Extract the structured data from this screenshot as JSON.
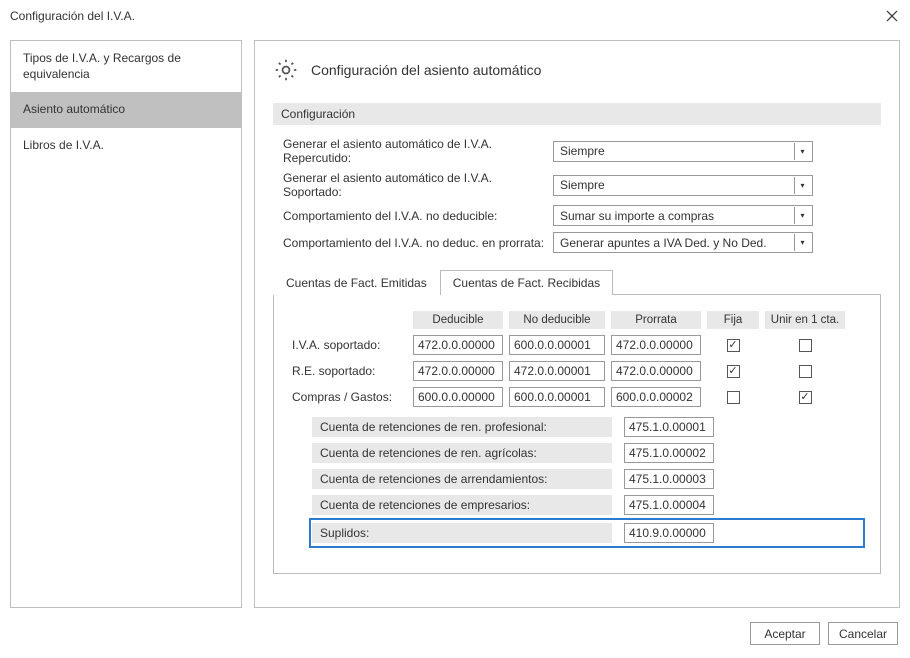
{
  "window": {
    "title": "Configuración del I.V.A."
  },
  "sidebar": {
    "items": [
      {
        "label": "Tipos de I.V.A. y Recargos de equivalencia"
      },
      {
        "label": "Asiento automático"
      },
      {
        "label": "Libros de I.V.A."
      }
    ]
  },
  "content": {
    "heading": "Configuración del asiento automático",
    "group_label": "Configuración",
    "rows": [
      {
        "label": "Generar el asiento automático de I.V.A. Repercutido:",
        "value": "Siempre"
      },
      {
        "label": "Generar el asiento automático de I.V.A. Soportado:",
        "value": "Siempre"
      },
      {
        "label": "Comportamiento del I.V.A. no deducible:",
        "value": "Sumar su importe a compras"
      },
      {
        "label": "Comportamiento del I.V.A. no deduc. en prorrata:",
        "value": "Generar apuntes a IVA Ded. y No Ded."
      }
    ],
    "tabs": [
      {
        "label": "Cuentas de Fact. Emitidas"
      },
      {
        "label": "Cuentas de Fact. Recibidas"
      }
    ],
    "grid": {
      "headers": [
        "Deducible",
        "No deducible",
        "Prorrata",
        "Fija",
        "Unir en 1 cta."
      ],
      "rows": [
        {
          "label": "I.V.A. soportado:",
          "ded": "472.0.0.00000",
          "noded": "600.0.0.00001",
          "pro": "472.0.0.00000",
          "fija": true,
          "unir": false
        },
        {
          "label": "R.E. soportado:",
          "ded": "472.0.0.00000",
          "noded": "472.0.0.00001",
          "pro": "472.0.0.00000",
          "fija": true,
          "unir": false
        },
        {
          "label": "Compras / Gastos:",
          "ded": "600.0.0.00000",
          "noded": "600.0.0.00001",
          "pro": "600.0.0.00002",
          "fija": false,
          "unir": true
        }
      ],
      "retenciones": [
        {
          "label": "Cuenta de retenciones de ren. profesional:",
          "value": "475.1.0.00001"
        },
        {
          "label": "Cuenta de retenciones de ren. agrícolas:",
          "value": "475.1.0.00002"
        },
        {
          "label": "Cuenta de retenciones de arrendamientos:",
          "value": "475.1.0.00003"
        },
        {
          "label": "Cuenta de retenciones de empresarios:",
          "value": "475.1.0.00004"
        },
        {
          "label": "Suplidos:",
          "value": "410.9.0.00000",
          "highlight": true
        }
      ]
    }
  },
  "footer": {
    "accept": "Aceptar",
    "cancel": "Cancelar"
  }
}
